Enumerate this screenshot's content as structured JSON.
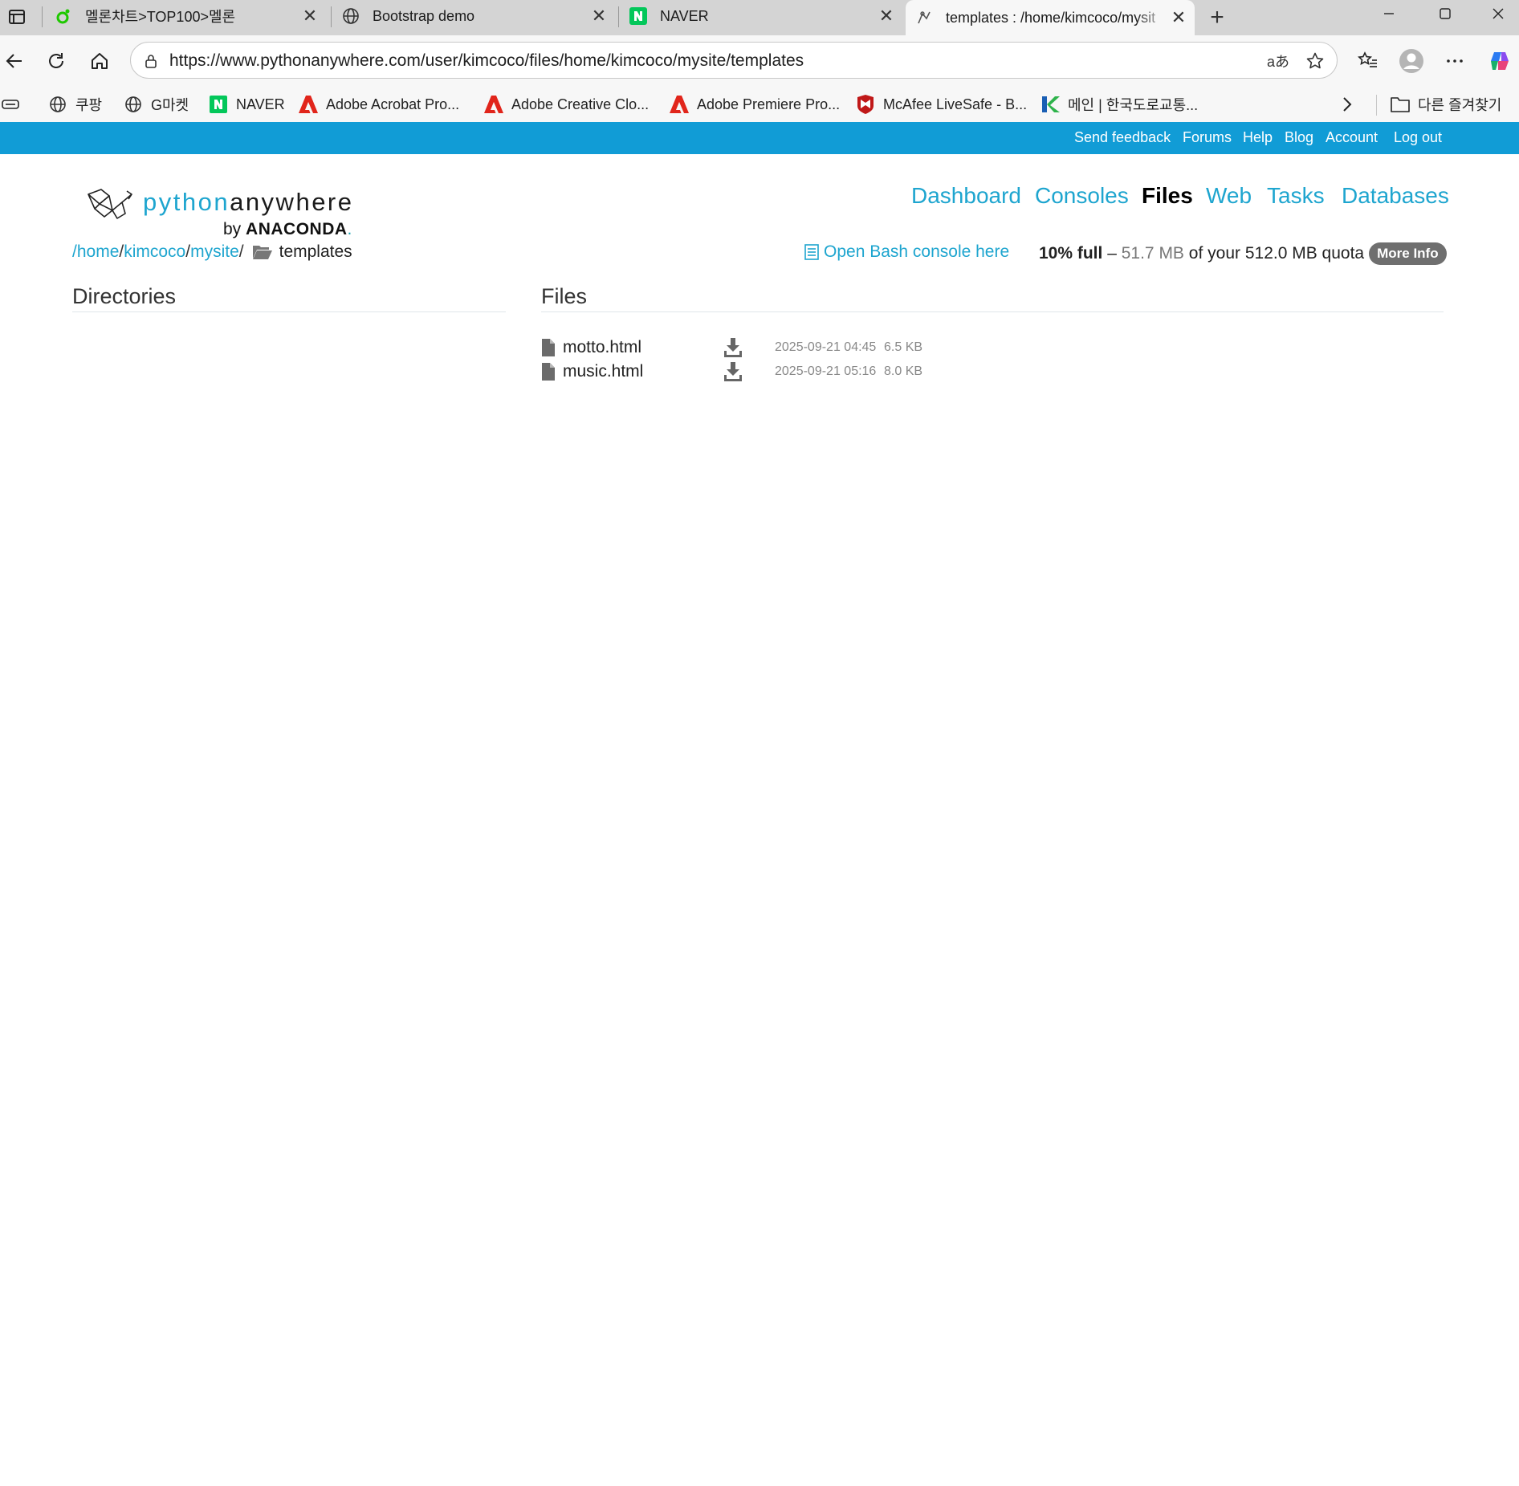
{
  "browser": {
    "tabs": [
      {
        "title": "멜론차트>TOP100>멜론",
        "icon": "melon-icon"
      },
      {
        "title": "Bootstrap demo",
        "icon": "globe-icon"
      },
      {
        "title": "NAVER",
        "icon": "naver-icon"
      },
      {
        "title": "templates : /home/kimcoco/mysit",
        "icon": "pythonanywhere-icon",
        "active": true
      }
    ],
    "url": "https://www.pythonanywhere.com/user/kimcoco/files/home/kimcoco/mysite/templates",
    "read_aloud_label": "aあ",
    "bookmarks": [
      {
        "label": "쿠팡",
        "icon": "globe-icon"
      },
      {
        "label": "G마켓",
        "icon": "globe-icon"
      },
      {
        "label": "NAVER",
        "icon": "naver-icon"
      },
      {
        "label": "Adobe Acrobat Pro...",
        "icon": "adobe-icon"
      },
      {
        "label": "Adobe Creative Clo...",
        "icon": "adobe-icon"
      },
      {
        "label": "Adobe Premiere Pro...",
        "icon": "adobe-icon"
      },
      {
        "label": "McAfee LiveSafe - B...",
        "icon": "mcafee-icon"
      },
      {
        "label": "메인 | 한국도로교통...",
        "icon": "koroad-icon"
      }
    ],
    "other_favorites": "다른 즐겨찾기"
  },
  "topbar": {
    "links": [
      "Send feedback",
      "Forums",
      "Help",
      "Blog",
      "Account",
      "Log out"
    ]
  },
  "logo": {
    "word1": "python",
    "word2": "anywhere",
    "by": "by",
    "brand": "ANACONDA",
    "brand_suffix": "."
  },
  "nav": {
    "items": [
      {
        "label": "Dashboard"
      },
      {
        "label": "Consoles"
      },
      {
        "label": "Files",
        "active": true
      },
      {
        "label": "Web"
      },
      {
        "label": "Tasks"
      },
      {
        "label": "Databases"
      }
    ]
  },
  "breadcrumb": {
    "root": "/",
    "parts": [
      "home",
      "kimcoco",
      "mysite"
    ],
    "separator": "/",
    "current": "templates"
  },
  "bash_link": "Open Bash console here",
  "quota": {
    "percent_label": "10% full",
    "dash": "–",
    "used": "51.7 MB",
    "of_text": "of your 512.0 MB quota",
    "more_info": "More Info",
    "fraction_full": 0.1
  },
  "directories": {
    "heading": "Directories",
    "items": []
  },
  "files": {
    "heading": "Files",
    "items": [
      {
        "name": "motto.html",
        "modified": "2025-09-21 04:45",
        "size": "6.5 KB"
      },
      {
        "name": "music.html",
        "modified": "2025-09-21 05:16",
        "size": "8.0 KB"
      }
    ]
  },
  "colors": {
    "brand_blue": "#119cd6",
    "link_blue": "#1ea5cf",
    "badge_gray": "#6f6f6f"
  }
}
